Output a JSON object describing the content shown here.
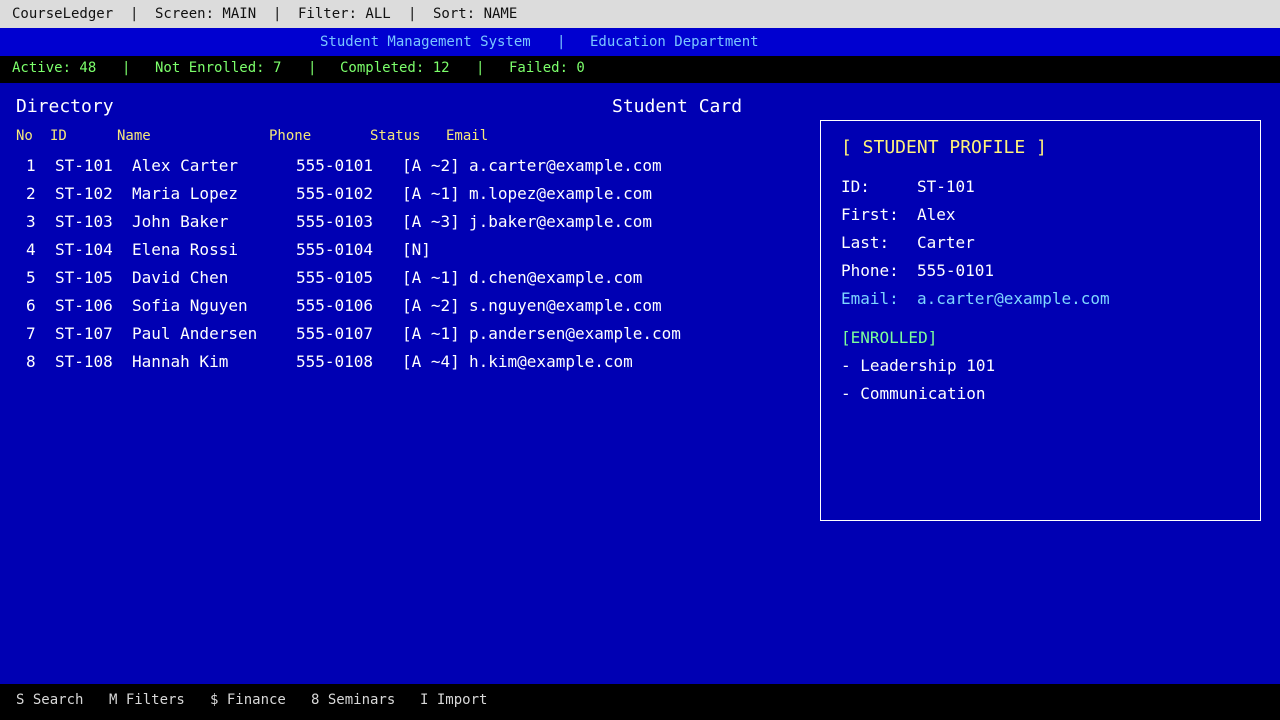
{
  "topbar": {
    "app_name": "CourseLedger",
    "screen": "Screen: MAIN",
    "filter": "Filter: ALL",
    "sort": "Sort: NAME",
    "separator": "|"
  },
  "titlebar": {
    "system": "Student Management System",
    "department": "Education Department",
    "separator": "|"
  },
  "status": {
    "active": "Active: 48",
    "not_enrolled": "Not Enrolled: 7",
    "completed": "Completed: 12",
    "failed": "Failed: 0",
    "separator": "|"
  },
  "directory": {
    "heading": "Directory",
    "columns": {
      "no": "No",
      "id": "ID",
      "name": "Name",
      "phone": "Phone",
      "status": "Status",
      "email": "Email"
    },
    "rows": [
      {
        "no": "1",
        "id": "ST-101",
        "name": "Alex Carter",
        "phone": "555-0101",
        "status": "[A ~2]",
        "email": "a.carter@example.com"
      },
      {
        "no": "2",
        "id": "ST-102",
        "name": "Maria Lopez",
        "phone": "555-0102",
        "status": "[A ~1]",
        "email": "m.lopez@example.com"
      },
      {
        "no": "3",
        "id": "ST-103",
        "name": "John Baker",
        "phone": "555-0103",
        "status": "[A ~3]",
        "email": "j.baker@example.com"
      },
      {
        "no": "4",
        "id": "ST-104",
        "name": "Elena Rossi",
        "phone": "555-0104",
        "status": "[N]",
        "email": ""
      },
      {
        "no": "5",
        "id": "ST-105",
        "name": "David Chen",
        "phone": "555-0105",
        "status": "[A ~1]",
        "email": "d.chen@example.com"
      },
      {
        "no": "6",
        "id": "ST-106",
        "name": "Sofia Nguyen",
        "phone": "555-0106",
        "status": "[A ~2]",
        "email": "s.nguyen@example.com"
      },
      {
        "no": "7",
        "id": "ST-107",
        "name": "Paul Andersen",
        "phone": "555-0107",
        "status": "[A ~1]",
        "email": "p.andersen@example.com"
      },
      {
        "no": "8",
        "id": "ST-108",
        "name": "Hannah Kim",
        "phone": "555-0108",
        "status": "[A ~4]",
        "email": "h.kim@example.com"
      }
    ]
  },
  "card": {
    "heading": "Student Card",
    "title": "[ STUDENT PROFILE ]",
    "fields": {
      "id_label": "ID:",
      "id_value": "ST-101",
      "first_label": "First:",
      "first_value": "Alex",
      "last_label": "Last:",
      "last_value": "Carter",
      "phone_label": "Phone:",
      "phone_value": "555-0101",
      "email_label": "Email:",
      "email_value": "a.carter@example.com"
    },
    "enrolled_tag": "[ENROLLED]",
    "courses": [
      "- Leadership 101",
      "- Communication"
    ]
  },
  "bottombar": {
    "search": "S Search",
    "filters": "M Filters",
    "finance": "$ Finance",
    "seminars": "8 Seminars",
    "import": "I Import"
  },
  "colors": {
    "background": "#0000b3",
    "title_bar": "#0000d0",
    "status_text": "#7cff6b",
    "column_header": "#f5e87a",
    "card_title": "#fff27a",
    "email_accent": "#7fd6ff",
    "enrolled_accent": "#7cff9a"
  }
}
